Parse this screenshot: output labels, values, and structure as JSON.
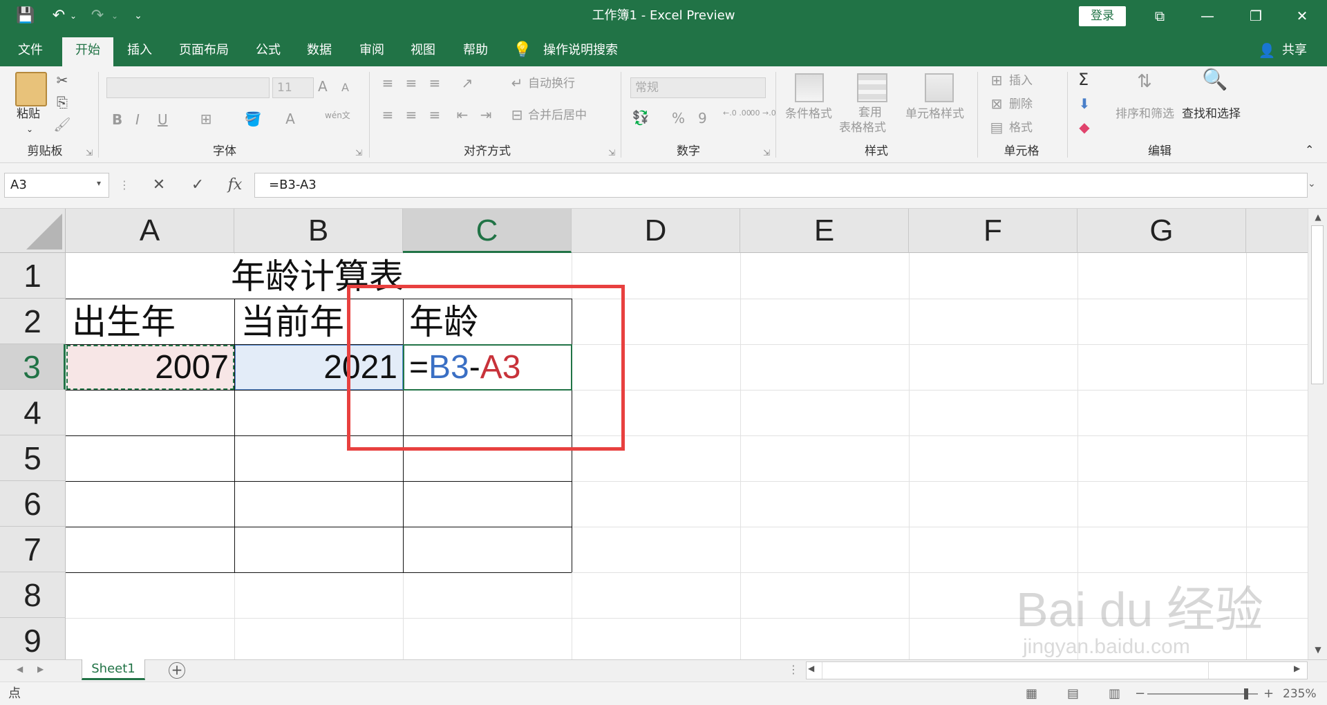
{
  "titlebar": {
    "title": "工作簿1  -  Excel Preview",
    "login": "登录",
    "qa_save": "💾",
    "qa_undo": "↶",
    "qa_redo": "↷",
    "qa_more": "⌄",
    "win_ribbon": "⧉",
    "win_minimize": "—",
    "win_restore": "❐",
    "win_close": "✕"
  },
  "tabs": [
    "文件",
    "开始",
    "插入",
    "页面布局",
    "公式",
    "数据",
    "审阅",
    "视图",
    "帮助"
  ],
  "search_tab": "操作说明搜索",
  "share": "共享",
  "ribbon": {
    "clipboard": {
      "label": "剪贴板",
      "paste": "粘贴"
    },
    "font": {
      "label": "字体",
      "size": "11",
      "bold": "B",
      "italic": "I",
      "underline": "U",
      "grow": "A",
      "shrink": "A",
      "wen": "wén文"
    },
    "align": {
      "label": "对齐方式",
      "wrap": "自动换行",
      "merge": "合并后居中"
    },
    "number": {
      "label": "数字",
      "format": "常规",
      "percent": "%",
      "comma": "9",
      "inc": "←.0 .00",
      "dec": ".00 →.0"
    },
    "styles": {
      "label": "样式",
      "cond": "条件格式",
      "table1": "套用",
      "table2": "表格格式",
      "cell": "单元格样式"
    },
    "cells": {
      "label": "单元格",
      "insert": "插入",
      "delete": "删除",
      "format": "格式"
    },
    "edit": {
      "label": "编辑",
      "sort": "排序和筛选",
      "find": "查找和选择",
      "sigma": "Σ"
    }
  },
  "formula_bar": {
    "name_box": "A3",
    "formula": "=B3-A3",
    "cancel": "✕",
    "enter": "✓",
    "fx": "fx"
  },
  "columns": [
    "A",
    "B",
    "C",
    "D",
    "E",
    "F",
    "G"
  ],
  "rows": [
    "1",
    "2",
    "3",
    "4",
    "5",
    "6",
    "7",
    "8",
    "9"
  ],
  "cells": {
    "title": "年龄计算表",
    "a2": "出生年",
    "b2": "当前年",
    "c2": "年龄",
    "a3": "2007",
    "b3": "2021",
    "c3_eq": "=",
    "c3_ref1": "B3",
    "c3_minus": "-",
    "c3_ref2": "A3"
  },
  "colors": {
    "accent": "#217346",
    "ref1": "#3a6fc4",
    "ref2": "#c8323a",
    "highlight": "#e8403f"
  },
  "sheet": {
    "name": "Sheet1",
    "add": "+"
  },
  "status": {
    "mode": "点",
    "zoom": "235%"
  },
  "watermark": {
    "brand": "Bai du 经验",
    "url": "jingyan.baidu.com"
  }
}
